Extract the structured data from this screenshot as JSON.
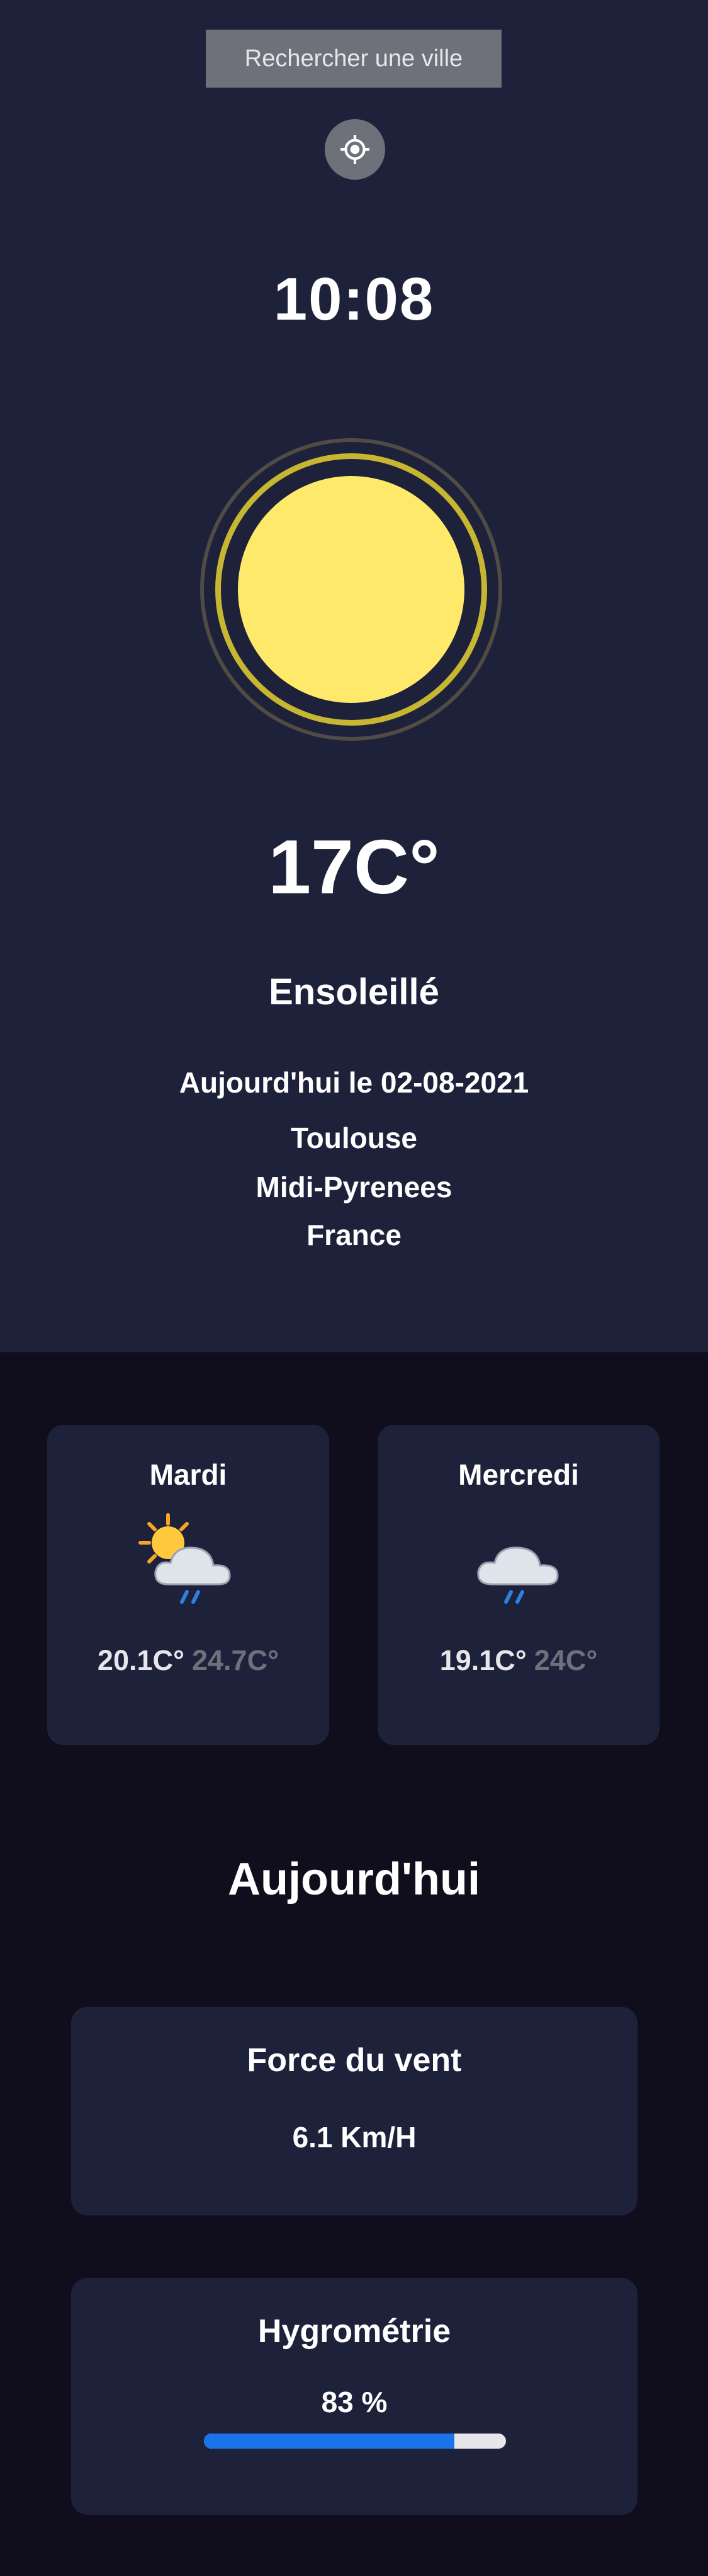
{
  "search": {
    "button_label": "Rechercher une ville"
  },
  "location_button": {
    "icon": "crosshair-icon"
  },
  "current": {
    "time": "10:08",
    "icon": "sun-icon",
    "temperature": "17C°",
    "condition": "Ensoleillé",
    "date": "Aujourd'hui le 02-08-2021",
    "city": "Toulouse",
    "region": "Midi-Pyrenees",
    "country": "France"
  },
  "forecast": [
    {
      "day": "Mardi",
      "icon": "sun-cloud-rain-icon",
      "min": "20.1C°",
      "max": "24.7C°"
    },
    {
      "day": "Mercredi",
      "icon": "cloud-rain-icon",
      "min": "19.1C°",
      "max": "24C°"
    }
  ],
  "today": {
    "title": "Aujourd'hui",
    "wind": {
      "title": "Force du vent",
      "value": "6.1 Km/H"
    },
    "humidity": {
      "title": "Hygrométrie",
      "value": "83 %",
      "percent": 83
    }
  },
  "colors": {
    "hero_bg": "#1e213a",
    "page_bg": "#100e1d",
    "sun": "#ffe96a",
    "accent_blue": "#1a73e8"
  }
}
